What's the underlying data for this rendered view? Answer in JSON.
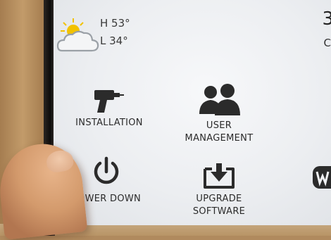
{
  "weather": {
    "high": "H 53°",
    "low": "L 34°",
    "icon": "partly-cloudy-icon"
  },
  "clock": {
    "time_partial": "3",
    "sub_partial": "C"
  },
  "menu": [
    {
      "id": "installation",
      "label": "INSTALLATION",
      "icon": "drill-icon"
    },
    {
      "id": "user-management",
      "label_line1": "USER",
      "label_line2": "MANAGEMENT",
      "icon": "users-icon"
    },
    {
      "id": "power-down",
      "label": "POWER DOWN",
      "icon": "power-icon"
    },
    {
      "id": "upgrade-software",
      "label_line1": "UPGRADE",
      "label_line2": "SOFTWARE",
      "icon": "download-icon"
    }
  ],
  "colors": {
    "icon": "#2b2b2b",
    "screen_bg": "#eef0f3",
    "cloud": "#9aa0a6",
    "sun": "#f2c200"
  }
}
